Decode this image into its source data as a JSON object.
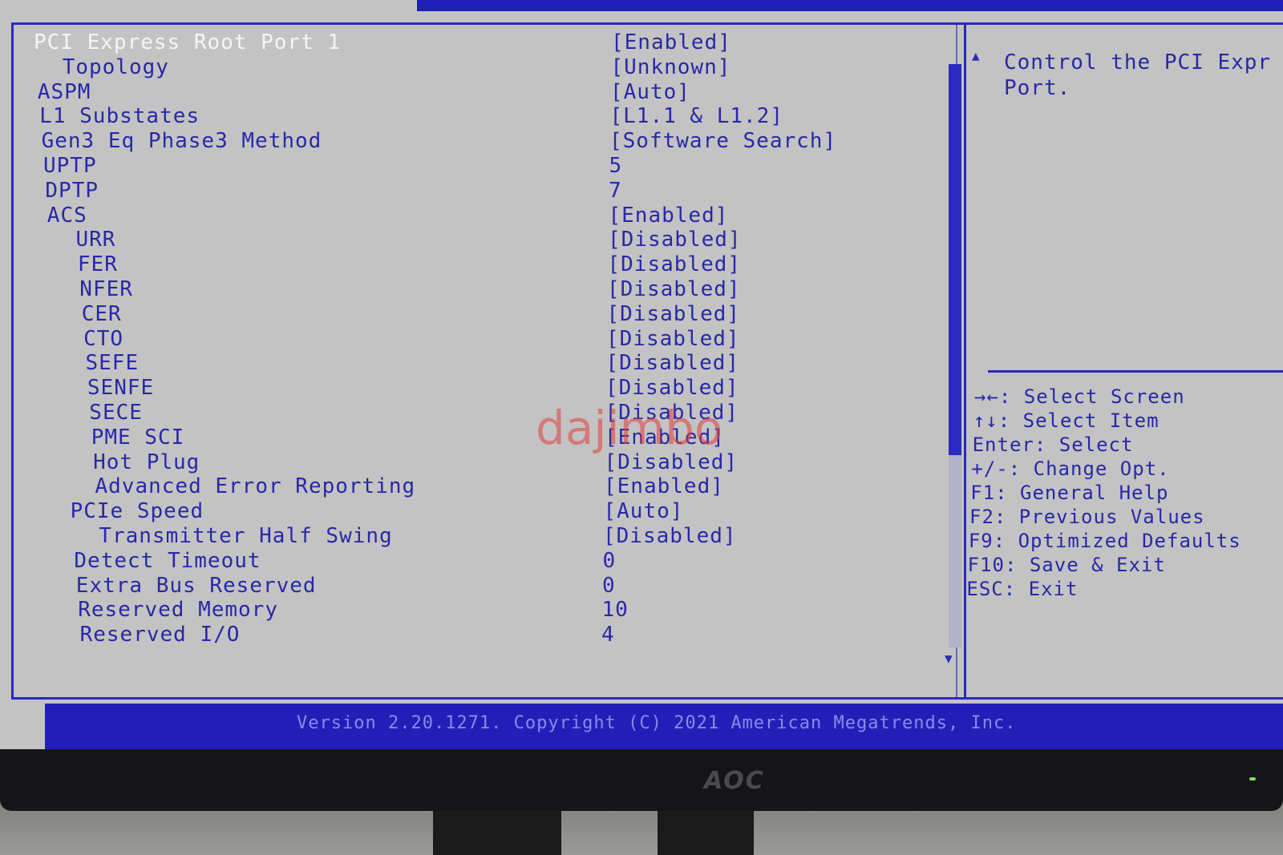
{
  "settings": [
    {
      "label": "PCI Express Root Port 1",
      "value": "[Enabled]",
      "selected": true
    },
    {
      "label": "  Topology",
      "value": "[Unknown]"
    },
    {
      "label": "ASPM",
      "value": "[Auto]"
    },
    {
      "label": "L1 Substates",
      "value": "[L1.1 & L1.2]"
    },
    {
      "label": "Gen3 Eq Phase3 Method",
      "value": "[Software Search]"
    },
    {
      "label": "UPTP",
      "value": "5"
    },
    {
      "label": "DPTP",
      "value": "7"
    },
    {
      "label": "ACS",
      "value": "[Enabled]"
    },
    {
      "label": "  URR",
      "value": "[Disabled]"
    },
    {
      "label": "  FER",
      "value": "[Disabled]"
    },
    {
      "label": "  NFER",
      "value": "[Disabled]"
    },
    {
      "label": "  CER",
      "value": "[Disabled]"
    },
    {
      "label": "  CTO",
      "value": "[Disabled]"
    },
    {
      "label": "  SEFE",
      "value": "[Disabled]"
    },
    {
      "label": "  SENFE",
      "value": "[Disabled]"
    },
    {
      "label": "  SECE",
      "value": "[Disabled]"
    },
    {
      "label": "  PME SCI",
      "value": "[Enabled]"
    },
    {
      "label": "  Hot Plug",
      "value": "[Disabled]"
    },
    {
      "label": "  Advanced Error Reporting",
      "value": "[Enabled]"
    },
    {
      "label": "PCIe Speed",
      "value": "[Auto]"
    },
    {
      "label": "  Transmitter Half Swing",
      "value": "[Disabled]"
    },
    {
      "label": "Detect Timeout",
      "value": "0"
    },
    {
      "label": "Extra Bus Reserved",
      "value": "0"
    },
    {
      "label": "Reserved Memory",
      "value": "10"
    },
    {
      "label": "Reserved I/O",
      "value": "4"
    }
  ],
  "help": {
    "text": "Control the PCI Expr\nPort."
  },
  "keys": [
    {
      "arrows": "→←",
      "text": ": Select Screen"
    },
    {
      "arrows": "↑↓",
      "text": ": Select Item"
    },
    {
      "arrows": "",
      "text": "Enter: Select"
    },
    {
      "arrows": "",
      "text": "+/-: Change Opt."
    },
    {
      "arrows": "",
      "text": "F1: General Help"
    },
    {
      "arrows": "",
      "text": "F2: Previous Values"
    },
    {
      "arrows": "",
      "text": "F9: Optimized Defaults"
    },
    {
      "arrows": "",
      "text": "F10: Save & Exit"
    },
    {
      "arrows": "",
      "text": "ESC: Exit"
    }
  ],
  "footer": {
    "version": "Version 2.20.1271. Copyright (C) 2021 American Megatrends, Inc."
  },
  "monitor": {
    "brand": "AOC"
  },
  "watermark": "dajimbo",
  "scrollbar": {
    "position_fraction": 0.0,
    "visible_fraction": 0.67
  },
  "colors": {
    "bios_blue": "#2a2ac0",
    "bios_gray": "#c3c3c3",
    "text_blue": "#2828a8",
    "highlight": "#f5f5f5"
  }
}
